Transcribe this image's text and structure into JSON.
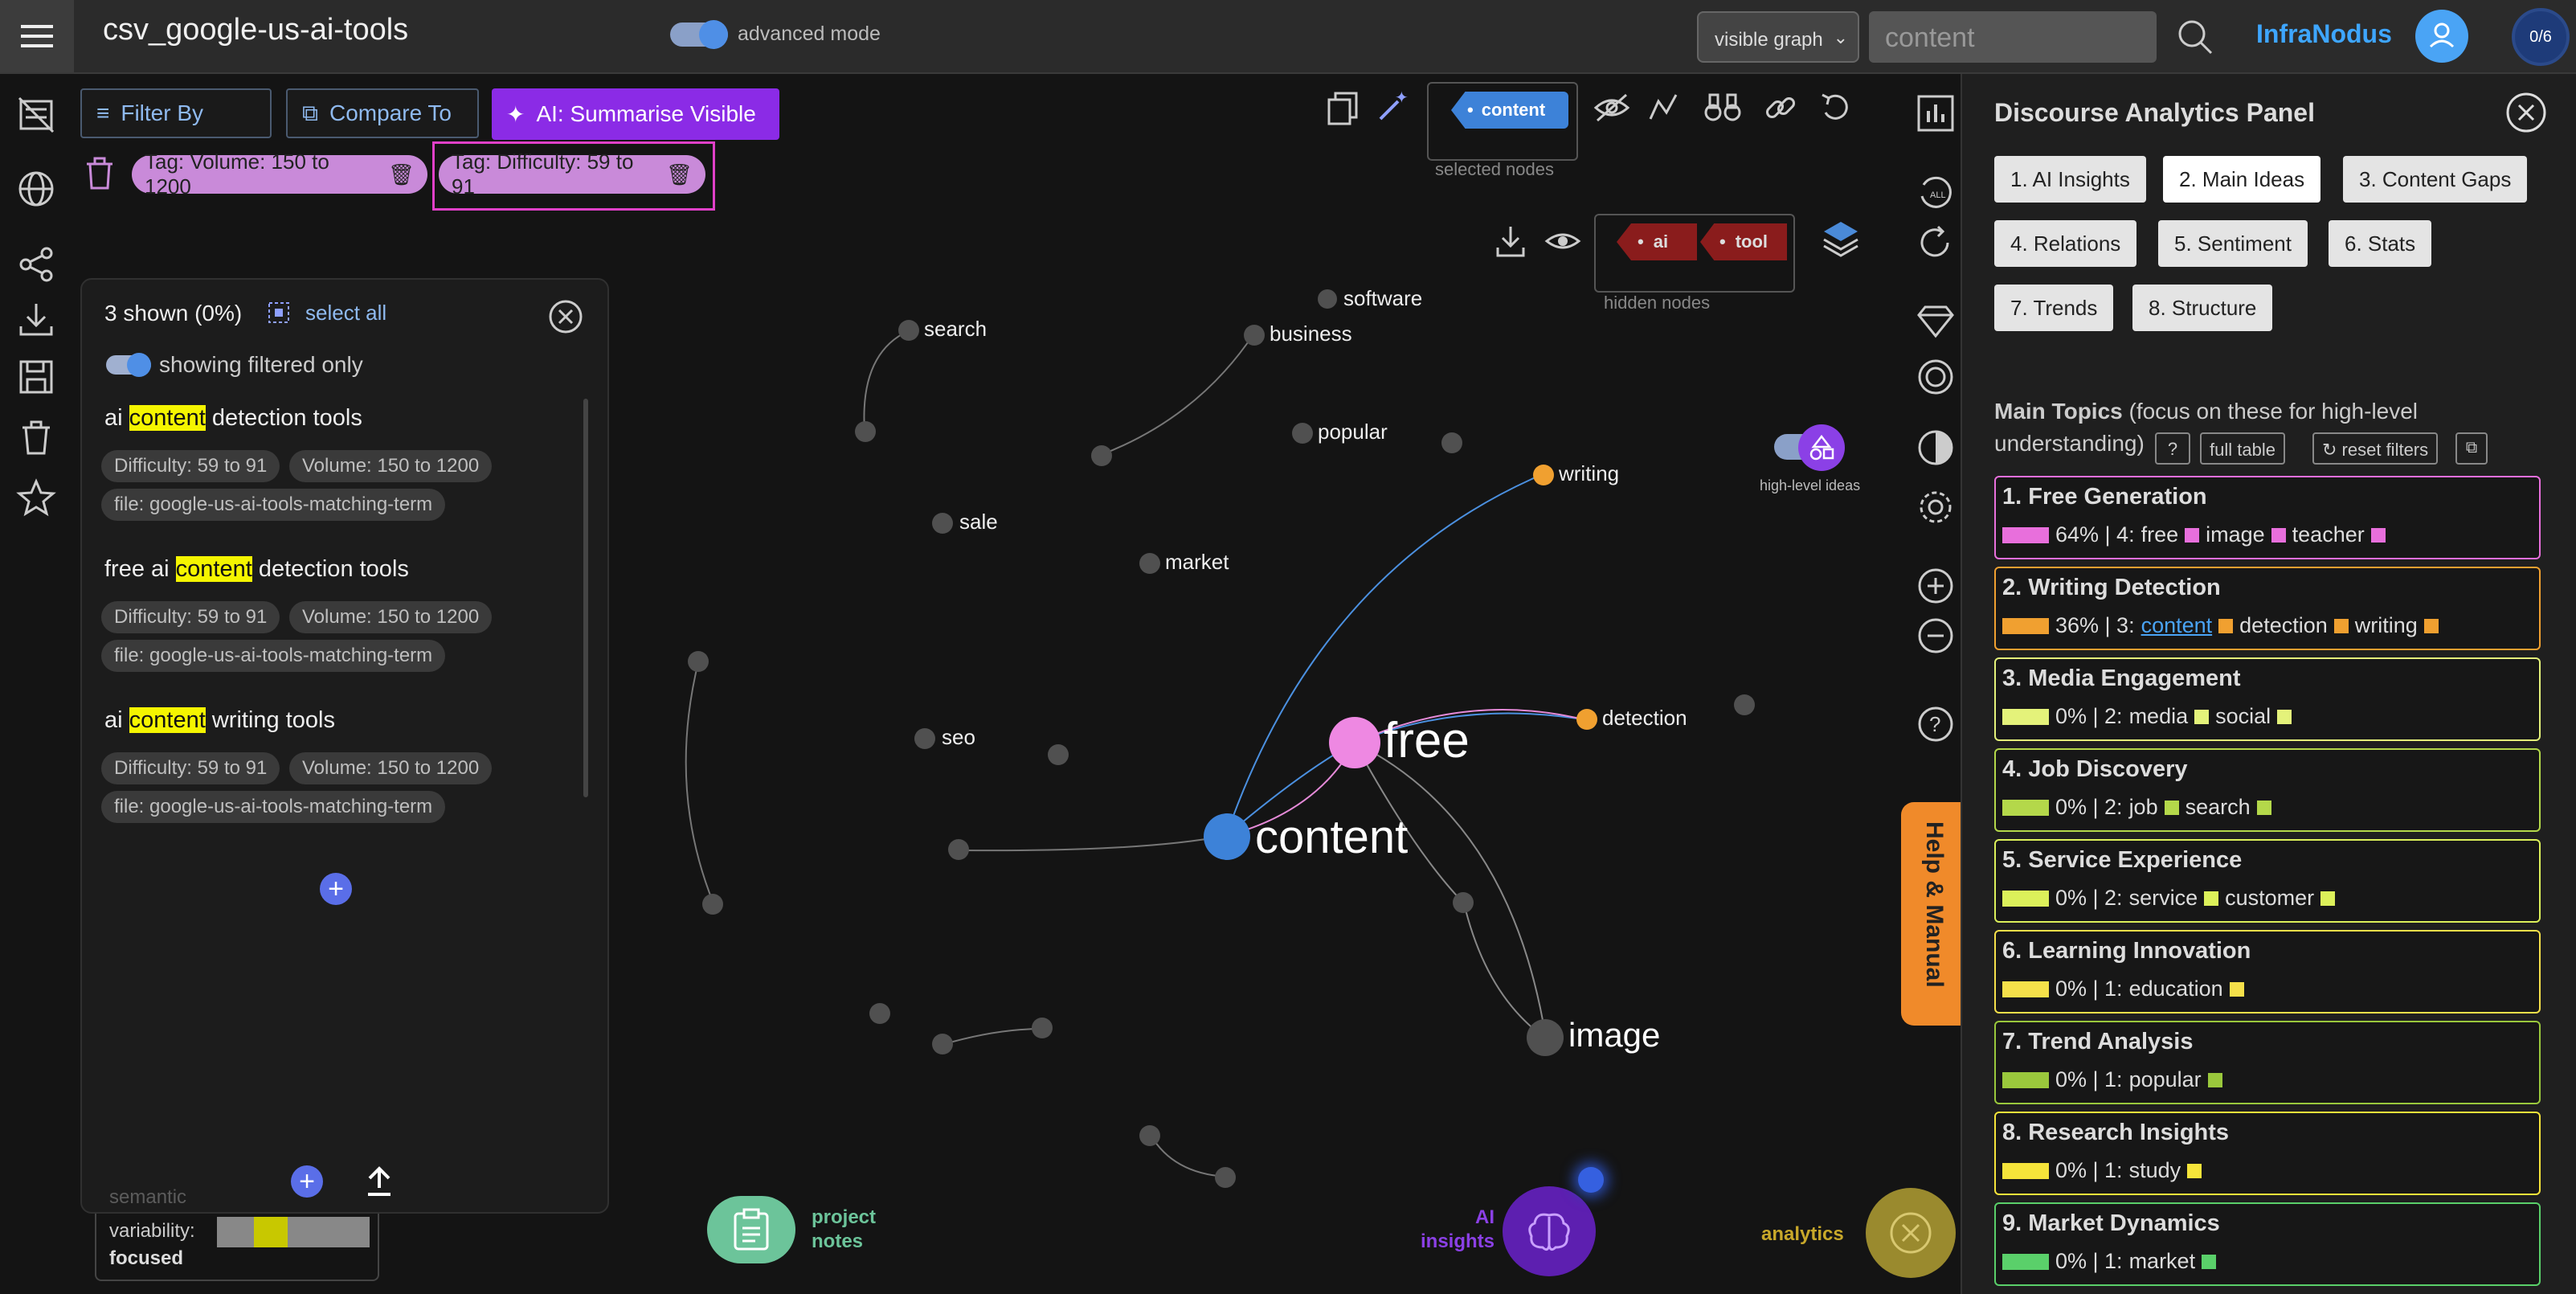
{
  "header": {
    "title": "csv_google-us-ai-tools",
    "advanced_label": "advanced mode",
    "graph_select": "visible graph",
    "search_placeholder": "content",
    "brand": "InfraNodus",
    "count_badge": "0/6"
  },
  "toolbar": {
    "filter_by": "Filter By",
    "compare_to": "Compare To",
    "ai_summarise": "AI: Summarise Visible",
    "tags": [
      "Tag: Volume: 150 to 1200",
      "Tag: Difficulty: 59 to 91"
    ],
    "selected_node_chip": "content",
    "selected_nodes_caption": "selected nodes",
    "hidden_chips": [
      "ai",
      "tool"
    ],
    "hidden_nodes_caption": "hidden nodes",
    "high_level_caption": "high-level ideas"
  },
  "results": {
    "shown": "3 shown (0%)",
    "select_all": "select all",
    "filtered_toggle": "showing filtered only",
    "items": [
      {
        "pre": "ai ",
        "hl": "content",
        "post": " detection tools",
        "chips": [
          "Difficulty: 59 to 91",
          "Volume: 150 to 1200",
          "file: google-us-ai-tools-matching-term"
        ]
      },
      {
        "pre": "free ai ",
        "hl": "content",
        "post": " detection tools",
        "chips": [
          "Difficulty: 59 to 91",
          "Volume: 150 to 1200",
          "file: google-us-ai-tools-matching-term"
        ]
      },
      {
        "pre": "ai ",
        "hl": "content",
        "post": " writing tools",
        "chips": [
          "Difficulty: 59 to 91",
          "Volume: 150 to 1200",
          "file: google-us-ai-tools-matching-term"
        ]
      }
    ]
  },
  "variability": {
    "label_top": "semantic",
    "label_mid": "variability:",
    "label_bottom": "focused"
  },
  "graph": {
    "nodes": {
      "search": "search",
      "software": "software",
      "business": "business",
      "popular": "popular",
      "writing": "writing",
      "sale": "sale",
      "market": "market",
      "detection": "detection",
      "seo": "seo",
      "free": "free",
      "content": "content",
      "image": "image"
    }
  },
  "bottom": {
    "project_notes": "project notes",
    "ai_insights": "AI insights",
    "analytics": "analytics",
    "help_manual": "Help & Manual"
  },
  "panel": {
    "title": "Discourse Analytics Panel",
    "tabs": [
      "1. AI Insights",
      "2. Main Ideas",
      "3. Content Gaps",
      "4. Relations",
      "5. Sentiment",
      "6. Stats",
      "7. Trends",
      "8. Structure"
    ],
    "main_topics_title": "Main Topics",
    "main_topics_note": "(focus on these for high-level",
    "main_topics_note2": "understanding)",
    "help_btn": "?",
    "full_table": "full table",
    "reset_filters": "reset filters",
    "topics": [
      {
        "title": "1. Free Generation",
        "pct": "64% | 4:",
        "words": [
          "free",
          "image",
          "teacher"
        ],
        "color": "#e86fdc",
        "bar": 0.64
      },
      {
        "title": "2. Writing Detection",
        "pct": "36% | 3:",
        "words": [
          "content",
          "detection",
          "writing"
        ],
        "color": "#f0a030",
        "bar": 0.36
      },
      {
        "title": "3. Media Engagement",
        "pct": "0% | 2:",
        "words": [
          "media",
          "social"
        ],
        "color": "#e4f27a",
        "bar": 0
      },
      {
        "title": "4. Job Discovery",
        "pct": "0% | 2:",
        "words": [
          "job",
          "search"
        ],
        "color": "#b4d84a",
        "bar": 0
      },
      {
        "title": "5. Service Experience",
        "pct": "0% | 2:",
        "words": [
          "service",
          "customer"
        ],
        "color": "#dcf05a",
        "bar": 0
      },
      {
        "title": "6. Learning Innovation",
        "pct": "0% | 1:",
        "words": [
          "education"
        ],
        "color": "#f5e04a",
        "bar": 0
      },
      {
        "title": "7. Trend Analysis",
        "pct": "0% | 1:",
        "words": [
          "popular"
        ],
        "color": "#9ac83c",
        "bar": 0
      },
      {
        "title": "8. Research Insights",
        "pct": "0% | 1:",
        "words": [
          "study"
        ],
        "color": "#f5e43a",
        "bar": 0
      },
      {
        "title": "9. Market Dynamics",
        "pct": "0% | 1:",
        "words": [
          "market"
        ],
        "color": "#5ad06a",
        "bar": 0
      }
    ]
  }
}
